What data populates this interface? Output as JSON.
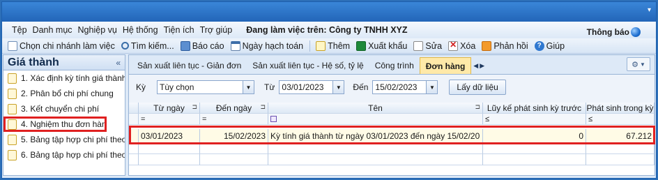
{
  "menu": {
    "items": [
      "Tệp",
      "Danh mục",
      "Nghiệp vụ",
      "Hệ thống",
      "Tiện ích",
      "Trợ giúp"
    ],
    "working_on": "Đang làm việc trên: Công ty TNHH XYZ",
    "notify": "Thông báo"
  },
  "toolbar": {
    "branch": "Chọn chi nhánh làm việc",
    "search": "Tìm kiếm...",
    "report": "Báo cáo",
    "posting_date": "Ngày hạch toán",
    "add": "Thêm",
    "export": "Xuất khẩu",
    "edit": "Sửa",
    "delete": "Xóa",
    "feedback": "Phản hồi",
    "help": "Giúp"
  },
  "left_panel": {
    "title": "Giá thành",
    "collapse": "«",
    "items": [
      "1. Xác định kỳ tính giá thành",
      "2. Phân bổ chi phí chung",
      "3. Kết chuyển chi phí",
      "4. Nghiệm thu đơn hàng",
      "5. Bảng tập hợp chi phí theo...",
      "6. Bảng tập hợp chi phí theo..."
    ]
  },
  "tabs": [
    "Sản xuất liên tục - Giản đơn",
    "Sản xuất liên tục - Hệ số, tỷ lệ",
    "Công trình",
    "Đơn hàng"
  ],
  "filter": {
    "period_label": "Kỳ",
    "period_value": "Tùy chọn",
    "from_label": "Từ",
    "from_value": "03/01/2023",
    "to_label": "Đến",
    "to_value": "15/02/2023",
    "fetch_button": "Lấy dữ liệu"
  },
  "grid": {
    "headers": [
      "Từ ngày",
      "Đến ngày",
      "Tên",
      "Lũy kế phát sinh kỳ trước",
      "Phát sinh trong kỳ"
    ],
    "filter_ops": [
      "=",
      "=",
      "",
      "≤",
      "≤"
    ],
    "rows": [
      {
        "from": "03/01/2023",
        "to": "15/02/2023",
        "name": "Kỳ tính giá thành từ ngày 03/01/2023 đến ngày 15/02/20",
        "prior": "0",
        "current": "67.212"
      }
    ]
  }
}
